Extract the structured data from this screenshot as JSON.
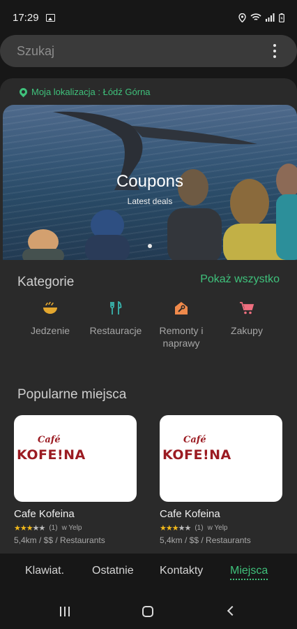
{
  "status": {
    "time": "17:29"
  },
  "search": {
    "placeholder": "Szukaj"
  },
  "location": {
    "label": "Moja lokalizacja : Łódź Górna"
  },
  "banner": {
    "title": "Coupons",
    "subtitle": "Latest deals"
  },
  "categories": {
    "title": "Kategorie",
    "show_all": "Pokaż wszystko",
    "items": [
      {
        "label": "Jedzenie",
        "icon": "food-bowl-icon",
        "color": "#e3a72f"
      },
      {
        "label": "Restauracje",
        "icon": "fork-knife-icon",
        "color": "#39b5ad"
      },
      {
        "label": "Remonty i naprawy",
        "icon": "repair-wrench-icon",
        "color": "#f08a4b"
      },
      {
        "label": "Zakupy",
        "icon": "shopping-cart-icon",
        "color": "#ef6f7f"
      }
    ]
  },
  "popular": {
    "title": "Popularne miejsca",
    "places": [
      {
        "logo_top": "Café",
        "logo_main": "KOFE!NA",
        "name": "Cafe Kofeina",
        "rating": 3,
        "max_rating": 5,
        "reviews": "(1)",
        "source": "w Yelp",
        "meta": "5,4km / $$ / Restaurants"
      },
      {
        "logo_top": "Café",
        "logo_main": "KOFE!NA",
        "name": "Cafe Kofeina",
        "rating": 3,
        "max_rating": 5,
        "reviews": "(1)",
        "source": "w Yelp",
        "meta": "5,4km / $$ / Restaurants"
      }
    ]
  },
  "tabs": [
    {
      "label": "Klawiat."
    },
    {
      "label": "Ostatnie"
    },
    {
      "label": "Kontakty"
    },
    {
      "label": "Miejsca",
      "active": true
    }
  ],
  "colors": {
    "accent": "#3fc17b",
    "panel": "#2a2a2a",
    "background": "#171717"
  }
}
